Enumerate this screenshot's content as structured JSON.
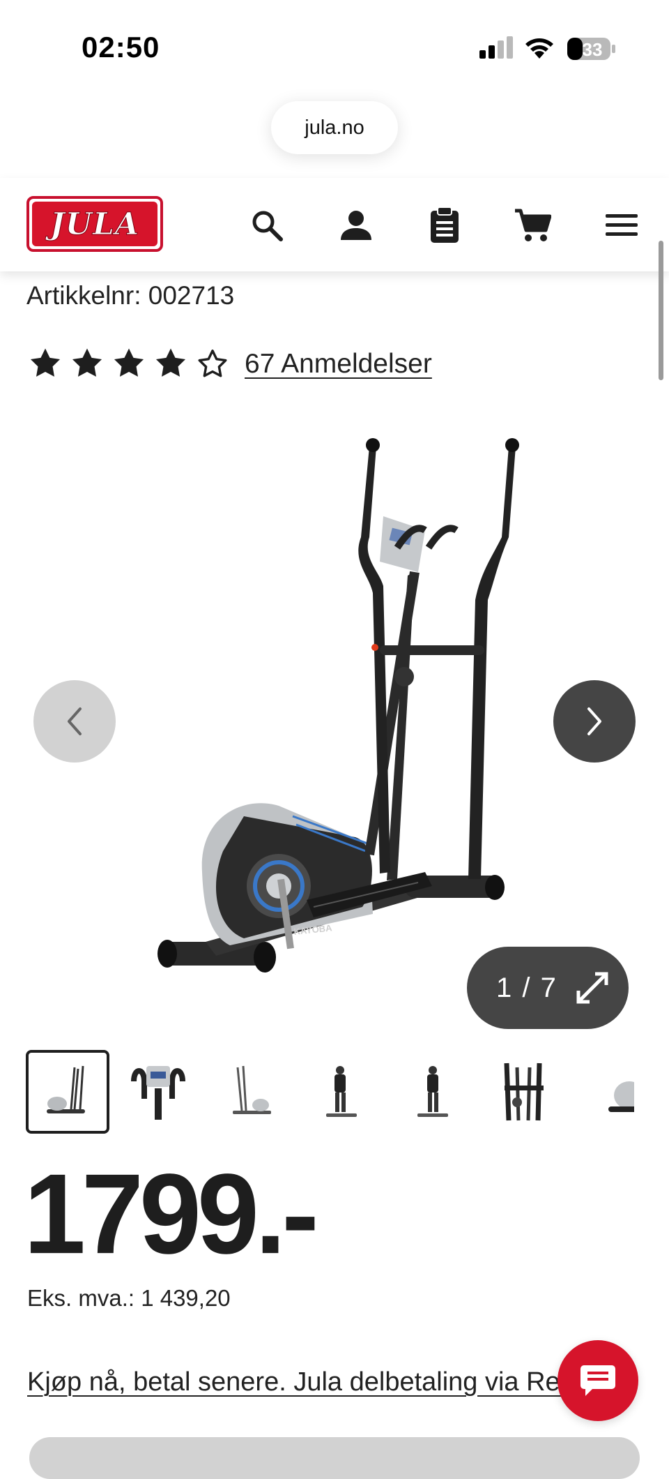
{
  "status_bar": {
    "time": "02:50",
    "battery": "33"
  },
  "browser": {
    "url": "jula.no"
  },
  "header": {
    "logo": "JULA"
  },
  "product": {
    "article_number": "Artikkelnr: 002713",
    "rating": {
      "value": 4,
      "max": 5
    },
    "reviews_label": "67 Anmeldelser",
    "brand_on_image": "KAYOBA",
    "gallery": {
      "counter": "1 / 7",
      "thumbnail_count": 7
    },
    "price": "1799.-",
    "price_ex_vat": "Eks. mva.: 1 439,20",
    "pay_later_link": "Kjøp nå, betal senere. Jula delbetaling via Resurs"
  },
  "colors": {
    "brand_red": "#d6142b",
    "dark_button": "#454545",
    "light_button": "#d2d2d2"
  }
}
